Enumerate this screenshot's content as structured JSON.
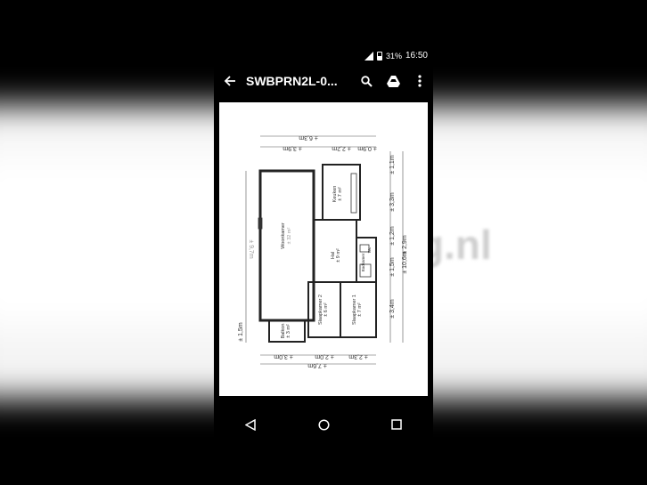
{
  "status_bar": {
    "network": "4G",
    "battery": "31%",
    "time": "16:50"
  },
  "app_bar": {
    "title": "SWBPRN2L-0...",
    "icons": [
      "back-arrow-icon",
      "search-icon",
      "drive-icon",
      "more-vert-icon"
    ]
  },
  "background": {
    "watermark_right": "g.nl"
  },
  "floorplan": {
    "dim_top_total": "± 6,3m",
    "dim_top_left": "± 3,9m",
    "dim_top_mid": "± 2,2m",
    "dim_top_right": "± 0,9m",
    "dim_right_1": "± 1,1m",
    "dim_right_2": "± 3,3m",
    "dim_right_3": "± 1,2m",
    "dim_right_4": "± 1,5m",
    "dim_right_5": "± 2,9m",
    "dim_right_total": "± 10,6m",
    "dim_right_6": "± 3,4m",
    "dim_left_total": "± 9,7m",
    "dim_left_bottom": "± 1,5m",
    "dim_bottom_left": "± 3,0m",
    "dim_bottom_mid": "± 2,0m",
    "dim_bottom_right": "± 2,3m",
    "dim_bottom_total": "± 7,6m",
    "room_woonkamer": "Woonkamer",
    "room_woonkamer_area": "± 32 m²",
    "room_keuken": "Keuken",
    "room_keuken_area": "± 7 m²",
    "room_hal": "Hal",
    "room_hal_area": "± 9 m²",
    "room_badkamer": "Badkamer",
    "room_wc": "Wc",
    "room_slaap2": "Slaapkamer 2",
    "room_slaap2_area": "± 6 m²",
    "room_slaap1": "Slaapkamer 1",
    "room_slaap1_area": "± 7 m²",
    "room_balkon": "Balkon",
    "room_balkon_area": "± 3 m²"
  },
  "navigation": [
    "back-triangle-icon",
    "home-circle-icon",
    "recents-square-icon"
  ]
}
